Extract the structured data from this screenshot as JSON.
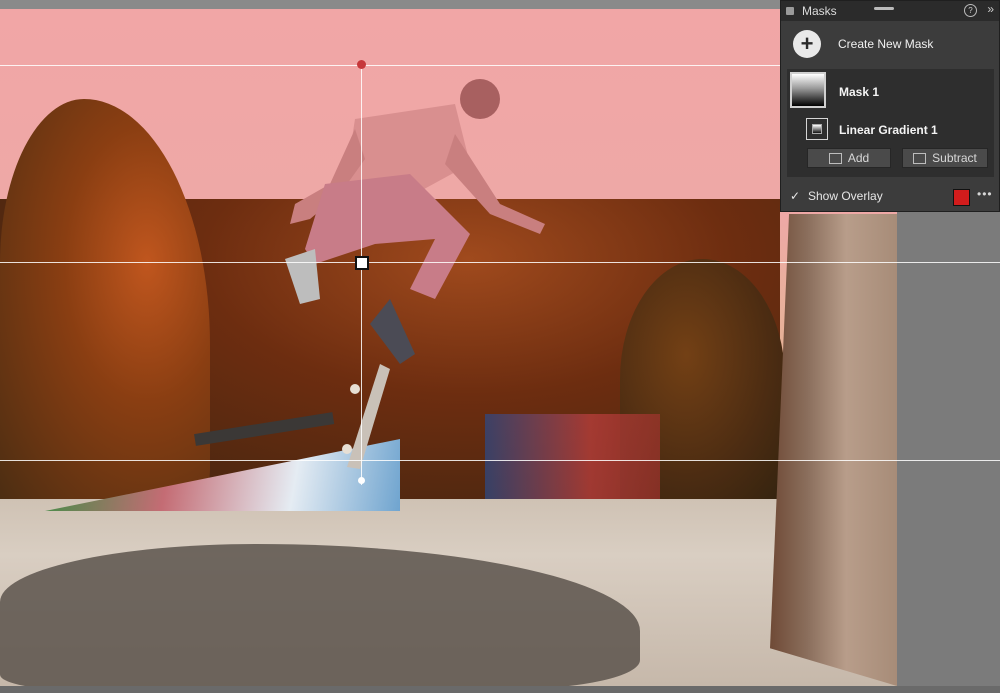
{
  "panel": {
    "title": "Masks",
    "help_icon": "?",
    "expand_icon": "»",
    "create_plus": "+",
    "create_label": "Create New Mask",
    "mask_name": "Mask 1",
    "component_name": "Linear Gradient 1",
    "add_label": "Add",
    "subtract_label": "Subtract",
    "overlay_check": "✓",
    "show_overlay_label": "Show Overlay",
    "overlay_checked": true,
    "overlay_color": "#d21c1c",
    "more_label": "•••"
  },
  "icons": [
    "panel-menu-icon",
    "help-icon",
    "expand-icon",
    "plus-icon",
    "mask-thumbnail",
    "linear-gradient-icon",
    "add-icon",
    "subtract-icon",
    "checkbox-icon",
    "more-icon"
  ]
}
